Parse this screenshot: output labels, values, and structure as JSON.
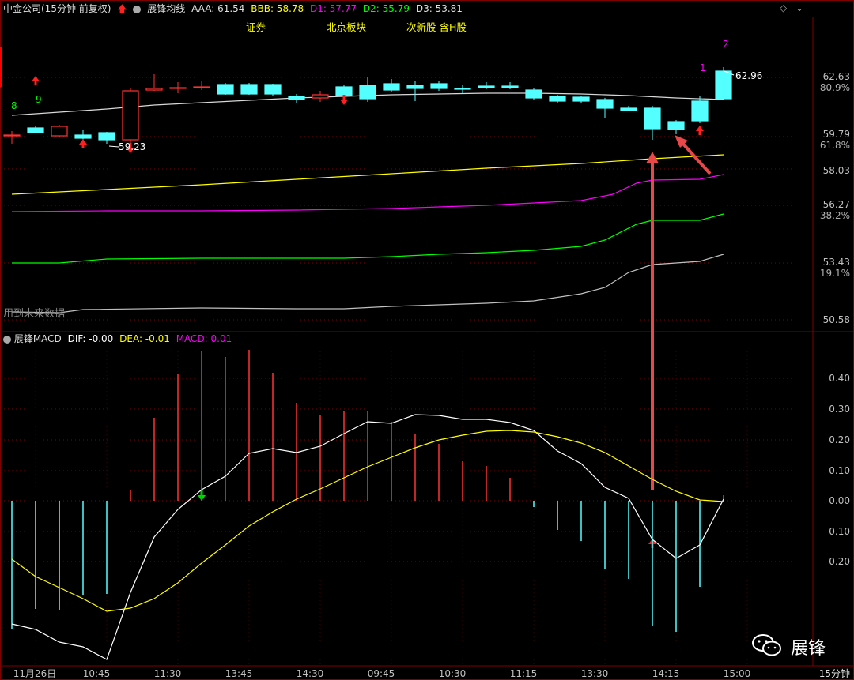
{
  "header": {
    "stock": "中金公司(15分钟 前复权)",
    "indicator": "展锋均线",
    "aaa": "AAA: 61.54",
    "bbb": "BBB: 58.78",
    "d1": "D1: 57.77",
    "d2": "D2: 55.79",
    "d3": "D3: 53.81"
  },
  "tags": [
    "证券",
    "北京板块",
    "次新股 含H股"
  ],
  "future_note": "用到未来数据",
  "macd_header": {
    "name": "展锋MACD",
    "dif": "DIF: -0.00",
    "dea": "DEA: -0.01",
    "macd": "MACD: 0.01"
  },
  "price_labels": [
    "62.63",
    "80.9%",
    "59.79",
    "61.8%",
    "58.03",
    "56.27",
    "38.2%",
    "53.43",
    "19.1%",
    "50.58"
  ],
  "macd_axis": [
    "0.40",
    "0.30",
    "0.20",
    "0.10",
    "0.00",
    "-0.10",
    "-0.20"
  ],
  "time_axis": [
    "11月26日",
    "10:45",
    "11:30",
    "13:45",
    "14:30",
    "09:45",
    "10:30",
    "11:15",
    "13:30",
    "14:15",
    "15:00"
  ],
  "period_label": "15分钟",
  "annotations": {
    "high_label": "62.96",
    "low_label": "59.23",
    "count_8": "8",
    "count_9": "9",
    "count_1": "1",
    "count_2": "2"
  },
  "watermark": "展锋",
  "colors": {
    "up": "#ff3232",
    "down": "#54ffff",
    "bbb": "#ffff00",
    "d1": "#ff00ff",
    "d2": "#00ff00",
    "d3": "#c0c0c0",
    "dif": "#ffffff",
    "dea": "#ffff00"
  }
}
